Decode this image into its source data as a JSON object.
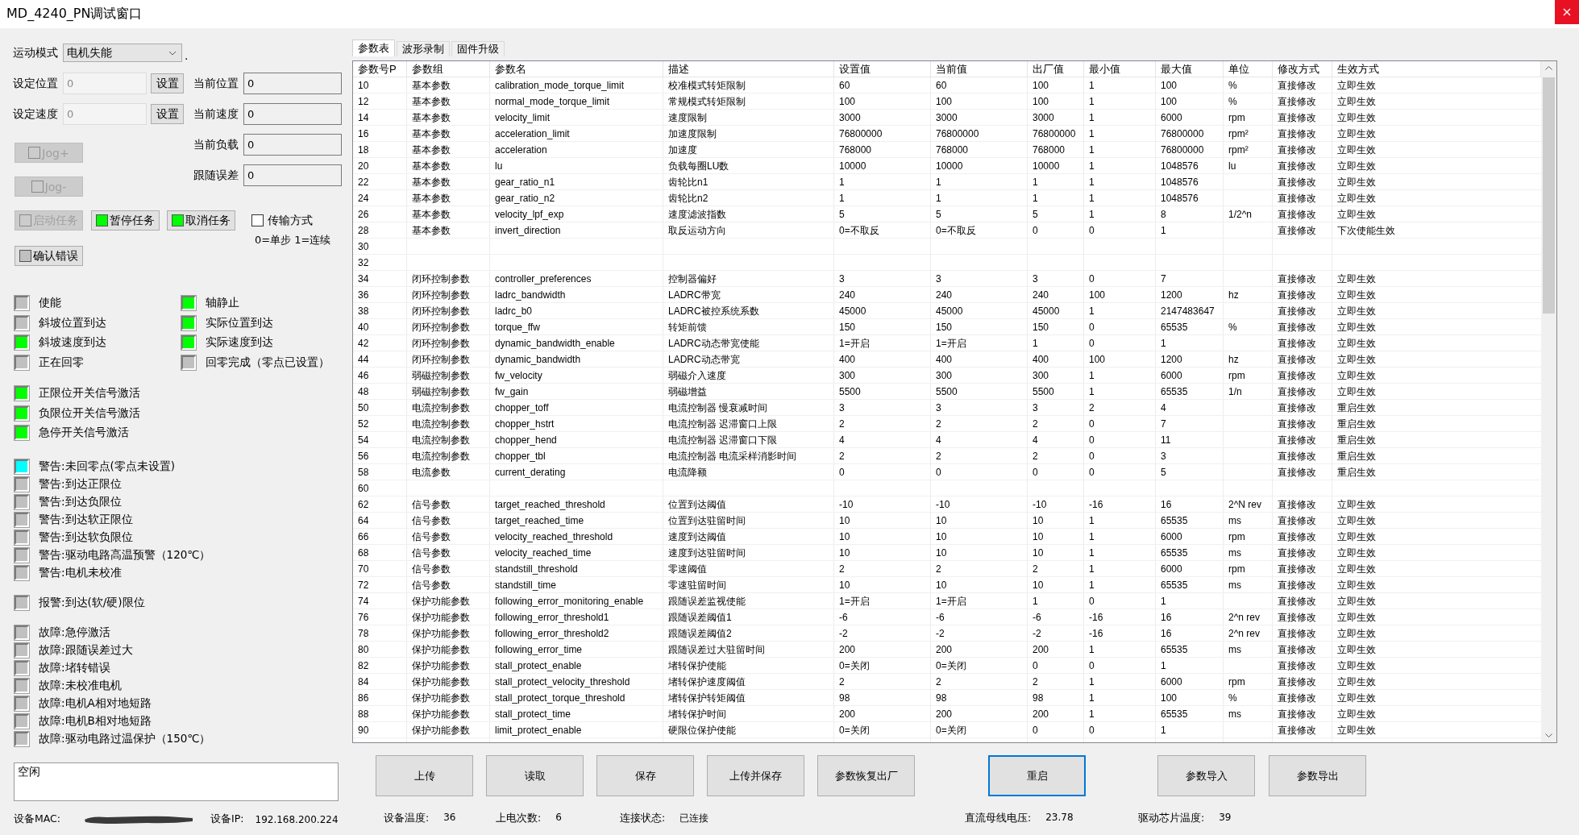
{
  "window": {
    "title": "MD_4240_PN调试窗口"
  },
  "motion_mode": {
    "label": "运动模式",
    "value": "电机失能",
    "suffix": "."
  },
  "setpoints": [
    {
      "label": "设定位置",
      "value": "0",
      "disabled": true,
      "button": "设置"
    },
    {
      "label": "设定速度",
      "value": "0",
      "disabled": true,
      "button": "设置"
    }
  ],
  "readouts": [
    {
      "label": "当前位置",
      "value": "0"
    },
    {
      "label": "当前速度",
      "value": "0"
    },
    {
      "label": "当前负载",
      "value": "0"
    },
    {
      "label": "跟随误差",
      "value": "0"
    }
  ],
  "jog_buttons": [
    {
      "label": "Jog+",
      "disabled": true,
      "color": "#cccccc"
    },
    {
      "label": "Jog-",
      "disabled": true,
      "color": "#cccccc"
    }
  ],
  "task_buttons": [
    {
      "label": "启动任务",
      "disabled": true,
      "color": "#cccccc"
    },
    {
      "label": "暂停任务",
      "disabled": false,
      "color": "#00ff00"
    },
    {
      "label": "取消任务",
      "disabled": false,
      "color": "#00ff00"
    }
  ],
  "transfer": {
    "label": "传输方式",
    "checked": false,
    "hint": "0=单步 1=连续"
  },
  "confirm_button": {
    "label": "确认错误",
    "disabled": false,
    "color": "#c0c0c0"
  },
  "status_grid": [
    {
      "label": "使能",
      "color": "#c0c0c0"
    },
    {
      "label": "轴静止",
      "color": "#00ff00"
    },
    {
      "label": "斜坡位置到达",
      "color": "#c0c0c0"
    },
    {
      "label": "实际位置到达",
      "color": "#00ff00"
    },
    {
      "label": "斜坡速度到达",
      "color": "#00ff00"
    },
    {
      "label": "实际速度到达",
      "color": "#00ff00"
    },
    {
      "label": "正在回零",
      "color": "#c0c0c0"
    },
    {
      "label": "回零完成（零点已设置）",
      "color": "#c0c0c0"
    }
  ],
  "signal_groups": [
    {
      "items": [
        {
          "label": "正限位开关信号激活",
          "color": "#00ff00"
        },
        {
          "label": "负限位开关信号激活",
          "color": "#00ff00"
        },
        {
          "label": "急停开关信号激活",
          "color": "#00ff00"
        }
      ]
    },
    {
      "items": [
        {
          "label": "警告:未回零点(零点未设置)",
          "color": "#00ffff"
        },
        {
          "label": "警告:到达正限位",
          "color": "#c0c0c0"
        },
        {
          "label": "警告:到达负限位",
          "color": "#c0c0c0"
        },
        {
          "label": "警告:到达软正限位",
          "color": "#c0c0c0"
        },
        {
          "label": "警告:到达软负限位",
          "color": "#c0c0c0"
        },
        {
          "label": "警告:驱动电路高温预警（120℃）",
          "color": "#c0c0c0"
        },
        {
          "label": "警告:电机未校准",
          "color": "#c0c0c0"
        }
      ]
    },
    {
      "items": [
        {
          "label": "报警:到达(软/硬)限位",
          "color": "#c0c0c0"
        }
      ]
    },
    {
      "items": [
        {
          "label": "故障:急停激活",
          "color": "#c0c0c0"
        },
        {
          "label": "故障:跟随误差过大",
          "color": "#c0c0c0"
        },
        {
          "label": "故障:堵转错误",
          "color": "#c0c0c0"
        },
        {
          "label": "故障:未校准电机",
          "color": "#c0c0c0"
        },
        {
          "label": "故障:电机A相对地短路",
          "color": "#c0c0c0"
        },
        {
          "label": "故障:电机B相对地短路",
          "color": "#c0c0c0"
        },
        {
          "label": "故障:驱动电路过温保护（150℃）",
          "color": "#c0c0c0"
        }
      ]
    }
  ],
  "status_text": "空闲",
  "device": {
    "mac_label": "设备MAC:",
    "ip_label": "设备IP:",
    "ip": "192.168.200.224"
  },
  "tabs": [
    {
      "label": "参数表",
      "selected": true
    },
    {
      "label": "波形录制",
      "selected": false
    },
    {
      "label": "固件升级",
      "selected": false
    }
  ],
  "table": {
    "columns": [
      "参数号P",
      "参数组",
      "参数名",
      "描述",
      "设置值",
      "当前值",
      "出厂值",
      "最小值",
      "最大值",
      "单位",
      "修改方式",
      "生效方式"
    ],
    "rows": [
      {
        "p": "10",
        "group": "基本参数",
        "name": "calibration_mode_torque_limit",
        "desc": "校准模式转矩限制",
        "set": "60",
        "cur": "60",
        "fac": "100",
        "min": "1",
        "max": "100",
        "unit": "%",
        "mod": "直接修改",
        "eff": "立即生效"
      },
      {
        "p": "12",
        "group": "基本参数",
        "name": "normal_mode_torque_limit",
        "desc": "常规模式转矩限制",
        "set": "100",
        "cur": "100",
        "fac": "100",
        "min": "1",
        "max": "100",
        "unit": "%",
        "mod": "直接修改",
        "eff": "立即生效"
      },
      {
        "p": "14",
        "group": "基本参数",
        "name": "velocity_limit",
        "desc": "速度限制",
        "set": "3000",
        "cur": "3000",
        "fac": "3000",
        "min": "1",
        "max": "6000",
        "unit": "rpm",
        "mod": "直接修改",
        "eff": "立即生效"
      },
      {
        "p": "16",
        "group": "基本参数",
        "name": "acceleration_limit",
        "desc": "加速度限制",
        "set": "76800000",
        "cur": "76800000",
        "fac": "76800000",
        "min": "1",
        "max": "76800000",
        "unit": "rpm²",
        "mod": "直接修改",
        "eff": "立即生效"
      },
      {
        "p": "18",
        "group": "基本参数",
        "name": "acceleration",
        "desc": "加速度",
        "set": "768000",
        "cur": "768000",
        "fac": "768000",
        "min": "1",
        "max": "76800000",
        "unit": "rpm²",
        "mod": "直接修改",
        "eff": "立即生效"
      },
      {
        "p": "20",
        "group": "基本参数",
        "name": "lu",
        "desc": "负载每圈LU数",
        "set": "10000",
        "cur": "10000",
        "fac": "10000",
        "min": "1",
        "max": "1048576",
        "unit": "lu",
        "mod": "直接修改",
        "eff": "立即生效"
      },
      {
        "p": "22",
        "group": "基本参数",
        "name": "gear_ratio_n1",
        "desc": "齿轮比n1",
        "set": "1",
        "cur": "1",
        "fac": "1",
        "min": "1",
        "max": "1048576",
        "mod": "直接修改",
        "eff": "立即生效"
      },
      {
        "p": "24",
        "group": "基本参数",
        "name": "gear_ratio_n2",
        "desc": "齿轮比n2",
        "set": "1",
        "cur": "1",
        "fac": "1",
        "min": "1",
        "max": "1048576",
        "mod": "直接修改",
        "eff": "立即生效"
      },
      {
        "p": "26",
        "group": "基本参数",
        "name": "velocity_lpf_exp",
        "desc": "速度滤波指数",
        "set": "5",
        "cur": "5",
        "fac": "5",
        "min": "1",
        "max": "8",
        "unit": "1/2^n",
        "mod": "直接修改",
        "eff": "立即生效"
      },
      {
        "p": "28",
        "group": "基本参数",
        "name": "invert_direction",
        "desc": "取反运动方向",
        "set": "0=不取反",
        "cur": "0=不取反",
        "fac": "0",
        "min": "0",
        "max": "1",
        "mod": "直接修改",
        "eff": "下次使能生效"
      },
      {
        "p": "30"
      },
      {
        "p": "32"
      },
      {
        "p": "34",
        "group": "闭环控制参数",
        "name": "controller_preferences",
        "desc": "控制器偏好",
        "set": "3",
        "cur": "3",
        "fac": "3",
        "min": "0",
        "max": "7",
        "mod": "直接修改",
        "eff": "立即生效"
      },
      {
        "p": "36",
        "group": "闭环控制参数",
        "name": "ladrc_bandwidth",
        "desc": "LADRC带宽",
        "set": "240",
        "cur": "240",
        "fac": "240",
        "min": "100",
        "max": "1200",
        "unit": "hz",
        "mod": "直接修改",
        "eff": "立即生效"
      },
      {
        "p": "38",
        "group": "闭环控制参数",
        "name": "ladrc_b0",
        "desc": "LADRC被控系统系数",
        "set": "45000",
        "cur": "45000",
        "fac": "45000",
        "min": "1",
        "max": "2147483647",
        "mod": "直接修改",
        "eff": "立即生效"
      },
      {
        "p": "40",
        "group": "闭环控制参数",
        "name": "torque_ffw",
        "desc": "转矩前馈",
        "set": "150",
        "cur": "150",
        "fac": "150",
        "min": "0",
        "max": "65535",
        "unit": "%",
        "mod": "直接修改",
        "eff": "立即生效"
      },
      {
        "p": "42",
        "group": "闭环控制参数",
        "name": "dynamic_bandwidth_enable",
        "desc": "LADRC动态带宽使能",
        "set": "1=开启",
        "cur": "1=开启",
        "fac": "1",
        "min": "0",
        "max": "1",
        "mod": "直接修改",
        "eff": "立即生效"
      },
      {
        "p": "44",
        "group": "闭环控制参数",
        "name": "dynamic_bandwidth",
        "desc": "LADRC动态带宽",
        "set": "400",
        "cur": "400",
        "fac": "400",
        "min": "100",
        "max": "1200",
        "unit": "hz",
        "mod": "直接修改",
        "eff": "立即生效"
      },
      {
        "p": "46",
        "group": "弱磁控制参数",
        "name": "fw_velocity",
        "desc": "弱磁介入速度",
        "set": "300",
        "cur": "300",
        "fac": "300",
        "min": "1",
        "max": "6000",
        "unit": "rpm",
        "mod": "直接修改",
        "eff": "立即生效"
      },
      {
        "p": "48",
        "group": "弱磁控制参数",
        "name": "fw_gain",
        "desc": "弱磁增益",
        "set": "5500",
        "cur": "5500",
        "fac": "5500",
        "min": "1",
        "max": "65535",
        "unit": "1/n",
        "mod": "直接修改",
        "eff": "立即生效"
      },
      {
        "p": "50",
        "group": "电流控制参数",
        "name": "chopper_toff",
        "desc": "电流控制器 慢衰减时间",
        "set": "3",
        "cur": "3",
        "fac": "3",
        "min": "2",
        "max": "4",
        "mod": "直接修改",
        "eff": "重启生效"
      },
      {
        "p": "52",
        "group": "电流控制参数",
        "name": "chopper_hstrt",
        "desc": "电流控制器 迟滞窗口上限",
        "set": "2",
        "cur": "2",
        "fac": "2",
        "min": "0",
        "max": "7",
        "mod": "直接修改",
        "eff": "重启生效"
      },
      {
        "p": "54",
        "group": "电流控制参数",
        "name": "chopper_hend",
        "desc": "电流控制器 迟滞窗口下限",
        "set": "4",
        "cur": "4",
        "fac": "4",
        "min": "0",
        "max": "11",
        "mod": "直接修改",
        "eff": "重启生效"
      },
      {
        "p": "56",
        "group": "电流控制参数",
        "name": "chopper_tbl",
        "desc": "电流控制器 电流采样消影时间",
        "set": "2",
        "cur": "2",
        "fac": "2",
        "min": "0",
        "max": "3",
        "mod": "直接修改",
        "eff": "重启生效"
      },
      {
        "p": "58",
        "group": "电流参数",
        "name": "current_derating",
        "desc": "电流降额",
        "set": "0",
        "cur": "0",
        "fac": "0",
        "min": "0",
        "max": "5",
        "mod": "直接修改",
        "eff": "重启生效"
      },
      {
        "p": "60"
      },
      {
        "p": "62",
        "group": "信号参数",
        "name": "target_reached_threshold",
        "desc": "位置到达阈值",
        "set": "-10",
        "cur": "-10",
        "fac": "-10",
        "min": "-16",
        "max": "16",
        "unit": "2^N rev",
        "mod": "直接修改",
        "eff": "立即生效"
      },
      {
        "p": "64",
        "group": "信号参数",
        "name": "target_reached_time",
        "desc": "位置到达驻留时间",
        "set": "10",
        "cur": "10",
        "fac": "10",
        "min": "1",
        "max": "65535",
        "unit": "ms",
        "mod": "直接修改",
        "eff": "立即生效"
      },
      {
        "p": "66",
        "group": "信号参数",
        "name": "velocity_reached_threshold",
        "desc": "速度到达阈值",
        "set": "10",
        "cur": "10",
        "fac": "10",
        "min": "1",
        "max": "6000",
        "unit": "rpm",
        "mod": "直接修改",
        "eff": "立即生效"
      },
      {
        "p": "68",
        "group": "信号参数",
        "name": "velocity_reached_time",
        "desc": "速度到达驻留时间",
        "set": "10",
        "cur": "10",
        "fac": "10",
        "min": "1",
        "max": "65535",
        "unit": "ms",
        "mod": "直接修改",
        "eff": "立即生效"
      },
      {
        "p": "70",
        "group": "信号参数",
        "name": "standstill_threshold",
        "desc": "零速阈值",
        "set": "2",
        "cur": "2",
        "fac": "2",
        "min": "1",
        "max": "6000",
        "unit": "rpm",
        "mod": "直接修改",
        "eff": "立即生效"
      },
      {
        "p": "72",
        "group": "信号参数",
        "name": "standstill_time",
        "desc": "零速驻留时间",
        "set": "10",
        "cur": "10",
        "fac": "10",
        "min": "1",
        "max": "65535",
        "unit": "ms",
        "mod": "直接修改",
        "eff": "立即生效"
      },
      {
        "p": "74",
        "group": "保护功能参数",
        "name": "following_error_monitoring_enable",
        "desc": "跟随误差监视使能",
        "set": "1=开启",
        "cur": "1=开启",
        "fac": "1",
        "min": "0",
        "max": "1",
        "mod": "直接修改",
        "eff": "立即生效"
      },
      {
        "p": "76",
        "group": "保护功能参数",
        "name": "following_error_threshold1",
        "desc": "跟随误差阈值1",
        "set": "-6",
        "cur": "-6",
        "fac": "-6",
        "min": "-16",
        "max": "16",
        "unit": "2^n rev",
        "mod": "直接修改",
        "eff": "立即生效"
      },
      {
        "p": "78",
        "group": "保护功能参数",
        "name": "following_error_threshold2",
        "desc": "跟随误差阈值2",
        "set": "-2",
        "cur": "-2",
        "fac": "-2",
        "min": "-16",
        "max": "16",
        "unit": "2^n rev",
        "mod": "直接修改",
        "eff": "立即生效"
      },
      {
        "p": "80",
        "group": "保护功能参数",
        "name": "following_error_time",
        "desc": "跟随误差过大驻留时间",
        "set": "200",
        "cur": "200",
        "fac": "200",
        "min": "1",
        "max": "65535",
        "unit": "ms",
        "mod": "直接修改",
        "eff": "立即生效"
      },
      {
        "p": "82",
        "group": "保护功能参数",
        "name": "stall_protect_enable",
        "desc": "堵转保护使能",
        "set": "0=关闭",
        "cur": "0=关闭",
        "fac": "0",
        "min": "0",
        "max": "1",
        "mod": "直接修改",
        "eff": "立即生效"
      },
      {
        "p": "84",
        "group": "保护功能参数",
        "name": "stall_protect_velocity_threshold",
        "desc": "堵转保护速度阈值",
        "set": "2",
        "cur": "2",
        "fac": "2",
        "min": "1",
        "max": "6000",
        "unit": "rpm",
        "mod": "直接修改",
        "eff": "立即生效"
      },
      {
        "p": "86",
        "group": "保护功能参数",
        "name": "stall_protect_torque_threshold",
        "desc": "堵转保护转矩阈值",
        "set": "98",
        "cur": "98",
        "fac": "98",
        "min": "1",
        "max": "100",
        "unit": "%",
        "mod": "直接修改",
        "eff": "立即生效"
      },
      {
        "p": "88",
        "group": "保护功能参数",
        "name": "stall_protect_time",
        "desc": "堵转保护时间",
        "set": "200",
        "cur": "200",
        "fac": "200",
        "min": "1",
        "max": "65535",
        "unit": "ms",
        "mod": "直接修改",
        "eff": "立即生效"
      },
      {
        "p": "90",
        "group": "保护功能参数",
        "name": "limit_protect_enable",
        "desc": "硬限位保护使能",
        "set": "0=关闭",
        "cur": "0=关闭",
        "fac": "0",
        "min": "0",
        "max": "1",
        "mod": "直接修改",
        "eff": "立即生效"
      }
    ]
  },
  "actions": [
    {
      "label": "上传",
      "focused": false
    },
    {
      "label": "读取",
      "focused": false
    },
    {
      "label": "保存",
      "focused": false
    },
    {
      "label": "上传并保存",
      "focused": false
    },
    {
      "label": "参数恢复出厂",
      "focused": false
    },
    {
      "label": "重启",
      "focused": true
    },
    {
      "label": "参数导入",
      "focused": false
    },
    {
      "label": "参数导出",
      "focused": false
    }
  ],
  "status_bar": [
    {
      "label": "设备温度:",
      "value": "36"
    },
    {
      "label": "上电次数:",
      "value": "6"
    },
    {
      "label": "连接状态:",
      "value": "已连接"
    },
    {
      "label": "直流母线电压:",
      "value": "23.78"
    },
    {
      "label": "驱动芯片温度:",
      "value": "39"
    }
  ]
}
